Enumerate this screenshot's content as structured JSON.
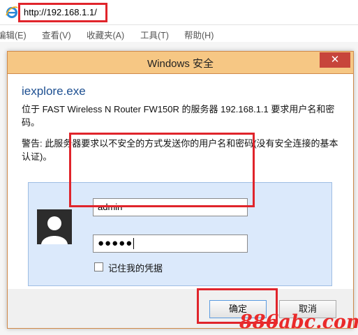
{
  "browser": {
    "url": "http://192.168.1.1/",
    "menu": [
      "编辑(E)",
      "查看(V)",
      "收藏夹(A)",
      "工具(T)",
      "帮助(H)"
    ]
  },
  "dialog": {
    "title": "Windows 安全",
    "close_glyph": "✕",
    "app_name": "iexplore.exe",
    "description": "位于 FAST Wireless N Router FW150R 的服务器 192.168.1.1 要求用户名和密码。",
    "warning": "警告: 此服务器要求以不安全的方式发送你的用户名和密码(没有安全连接的基本认证)。",
    "username_value": "admin",
    "password_mask": "●●●●●",
    "remember_label": "记住我的凭据",
    "remember_checked": false,
    "ok_label": "确定",
    "cancel_label": "取消"
  },
  "watermark": "886abc.com",
  "colors": {
    "highlight": "#e0242b",
    "titlebar": "#f6c784",
    "panel": "#dbe9fb",
    "close": "#c7453b"
  }
}
